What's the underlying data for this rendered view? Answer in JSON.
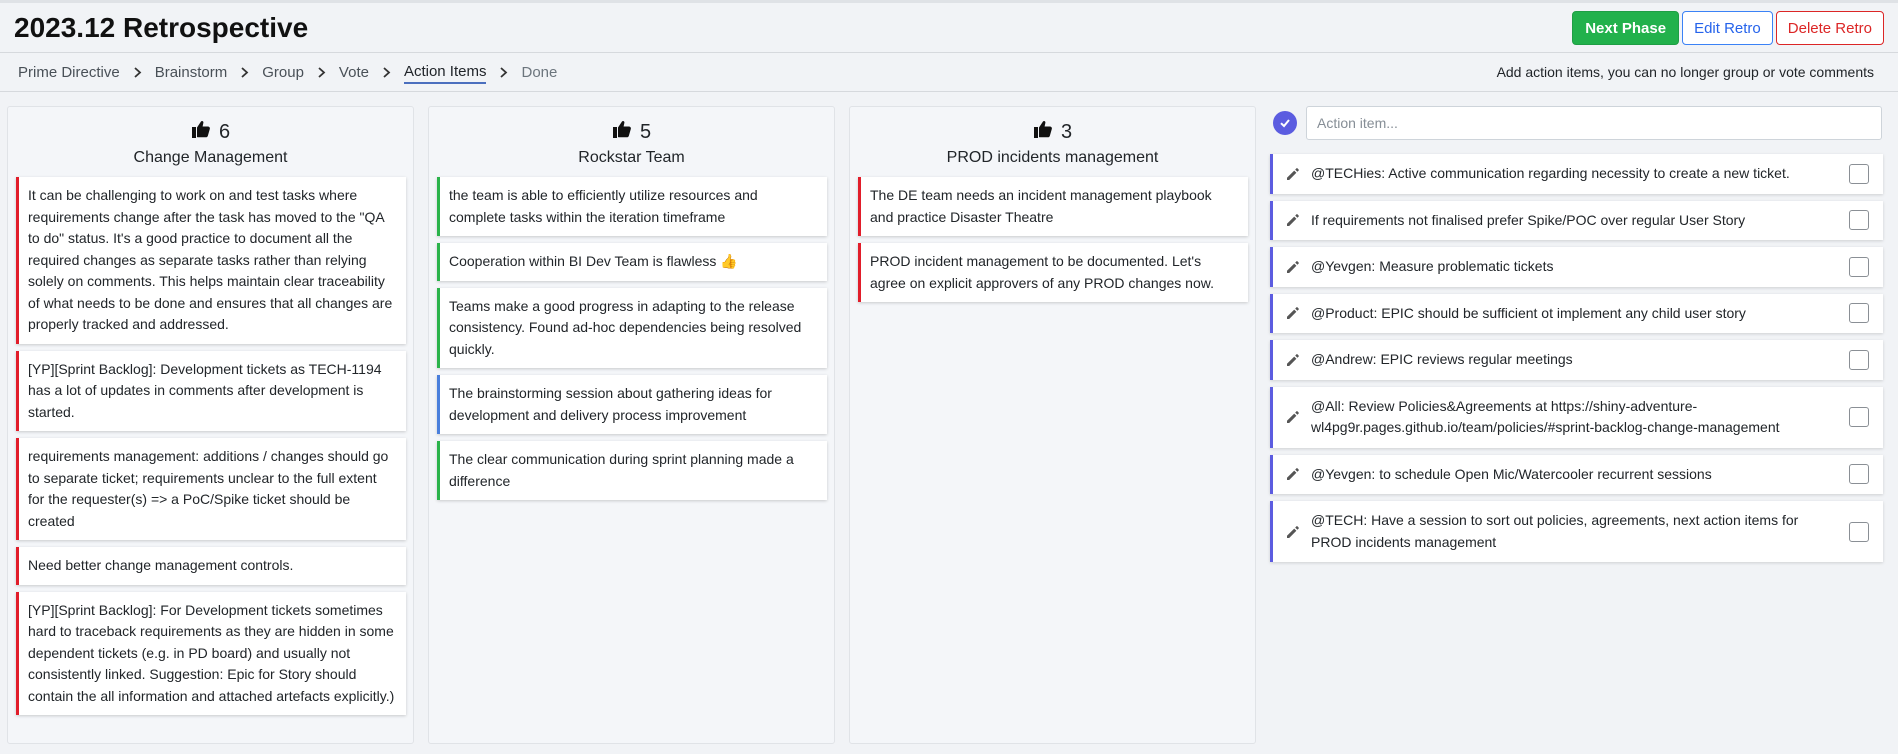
{
  "header": {
    "title": "2023.12 Retrospective",
    "buttons": {
      "next": "Next Phase",
      "edit": "Edit Retro",
      "delete": "Delete Retro"
    }
  },
  "phases": {
    "items": [
      "Prime Directive",
      "Brainstorm",
      "Group",
      "Vote",
      "Action Items",
      "Done"
    ],
    "active": "Action Items",
    "hint": "Add action items, you can no longer group or vote comments"
  },
  "columns": [
    {
      "votes": "6",
      "title": "Change Management",
      "cards": [
        {
          "text": "It can be challenging to work on and test tasks where requirements change after the task has moved to the \"QA to do\" status. It's a good practice to document all the required changes as separate tasks rather than relying solely on comments. This helps maintain clear traceability of what needs to be done and ensures that all changes are properly tracked and addressed.",
          "color": "red"
        },
        {
          "text": "[YP][Sprint Backlog]: Development tickets as TECH-1194 has a lot of updates in comments after development is started.",
          "color": "red"
        },
        {
          "text": "requirements management: additions / changes should go to separate ticket; requirements unclear to the full extent for the requester(s) => a PoC/Spike ticket should be created",
          "color": "red"
        },
        {
          "text": "Need better change management controls.",
          "color": "red"
        },
        {
          "text": "[YP][Sprint Backlog]: For Development tickets sometimes hard to traceback requirements as they are hidden in some dependent tickets (e.g. in PD board) and usually not consistently linked. Suggestion: Epic for Story should contain the all information and attached artefacts explicitly.)",
          "color": "red"
        }
      ]
    },
    {
      "votes": "5",
      "title": "Rockstar Team",
      "cards": [
        {
          "text": "the team is able to efficiently utilize resources and complete tasks within the iteration timeframe",
          "color": "green"
        },
        {
          "text": "Cooperation within BI Dev Team is flawless 👍",
          "color": "green"
        },
        {
          "text": "Teams make a good progress in adapting to the release consistency. Found ad-hoc dependencies being resolved quickly.",
          "color": "green"
        },
        {
          "text": "The brainstorming session about gathering ideas for development and delivery process improvement",
          "color": "blue"
        },
        {
          "text": "The clear communication during sprint planning made a difference",
          "color": "green"
        }
      ]
    },
    {
      "votes": "3",
      "title": "PROD incidents management",
      "cards": [
        {
          "text": "The DE team needs an incident management playbook and practice Disaster Theatre",
          "color": "red"
        },
        {
          "text": "PROD incident management to be documented. Let's agree on explicit approvers of any PROD changes now.",
          "color": "red"
        }
      ]
    }
  ],
  "actions": {
    "placeholder": "Action item...",
    "items": [
      "@TECHies: Active communication regarding necessity to create a new ticket.",
      "If requirements not finalised prefer Spike/POC over regular User Story",
      "@Yevgen: Measure problematic tickets",
      "@Product: EPIC should be sufficient ot implement any child user story",
      "@Andrew: EPIC reviews regular meetings",
      "@All: Review Policies&Agreements at https://shiny-adventure-wl4pg9r.pages.github.io/team/policies/#sprint-backlog-change-management",
      "@Yevgen: to schedule Open Mic/Watercooler recurrent sessions",
      "@TECH: Have a session to sort out policies, agreements, next action items for PROD incidents management"
    ]
  },
  "colors": {
    "red": "#e11d2a",
    "green": "#2bb34b",
    "blue": "#4a7fdc",
    "accent": "#5c5ce0",
    "next": "#22b14c"
  },
  "icons": {
    "vote": "thumbs-up-icon",
    "edit": "pencil-icon",
    "submit": "check-circle-icon",
    "separator": "chevron-right-icon"
  }
}
